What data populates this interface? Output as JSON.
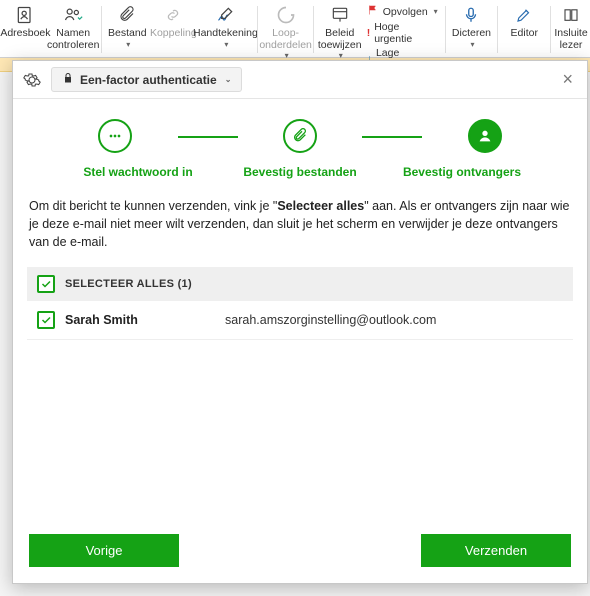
{
  "ribbon": {
    "adresboek": "Adresboek",
    "namen": "Namen\ncontroleren",
    "bestand": "Bestand",
    "koppeling": "Koppeling",
    "handtekening": "Handtekening",
    "loop": "Loop-\nonderdelen",
    "beleid": "Beleid\ntoewijzen",
    "opvolgen": "Opvolgen",
    "hoge": "Hoge urgentie",
    "lage": "Lage urgentie",
    "dicteren": "Dicteren",
    "editor": "Editor",
    "insluite": "Insluite\nlezer"
  },
  "modal": {
    "auth_label": "Een-factor authenticatie",
    "steps": {
      "s1": "Stel wachtwoord in",
      "s2": "Bevestig bestanden",
      "s3": "Bevestig ontvangers"
    },
    "instruction_pre": "Om dit bericht te kunnen verzenden, vink je \"",
    "instruction_bold": "Selecteer alles",
    "instruction_post": "\" aan. Als er ontvangers zijn naar wie je deze e-mail niet meer wilt verzenden, dan sluit je het scherm en verwijder je deze ontvangers van de e-mail.",
    "select_all": "SELECTEER ALLES (1)",
    "recipients": [
      {
        "name": "Sarah Smith",
        "email": "sarah.amszorginstelling@outlook.com"
      }
    ],
    "btn_prev": "Vorige",
    "btn_send": "Verzenden"
  }
}
